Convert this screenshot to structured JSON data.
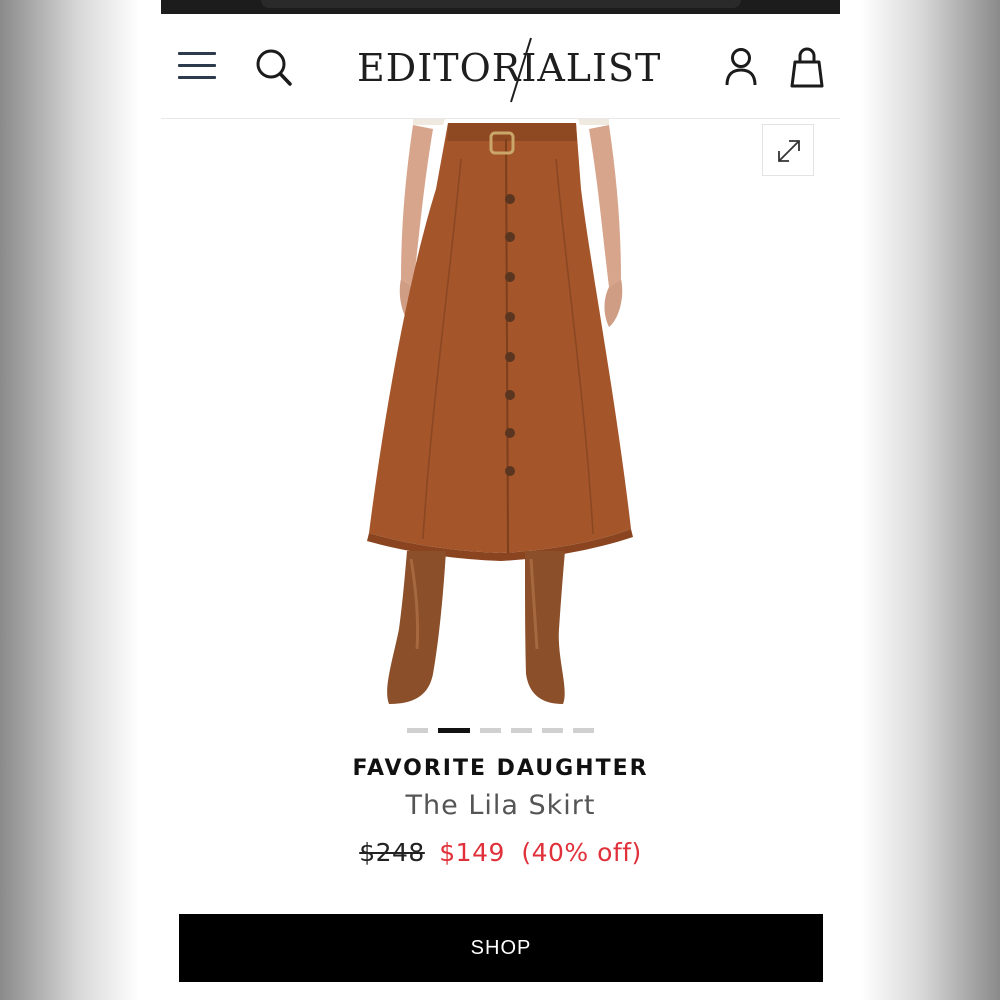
{
  "header": {
    "logo_text": "EDITORIALIST",
    "icons": [
      "menu-icon",
      "search-icon",
      "account-icon",
      "bag-icon"
    ]
  },
  "gallery": {
    "image": "brown-button-front-midi-skirt-with-boots",
    "expand_icon": "expand-icon",
    "dots_count": 6,
    "active_index": 1
  },
  "product": {
    "brand": "FAVORITE DAUGHTER",
    "name": "The Lila Skirt",
    "original_price": "$248",
    "sale_price": "$149",
    "discount": "(40% off)"
  },
  "cta": {
    "label": "SHOP"
  },
  "colors": {
    "accent_red": "#e0303a",
    "skirt_brown": "#a4552a",
    "button_black": "#000000"
  }
}
